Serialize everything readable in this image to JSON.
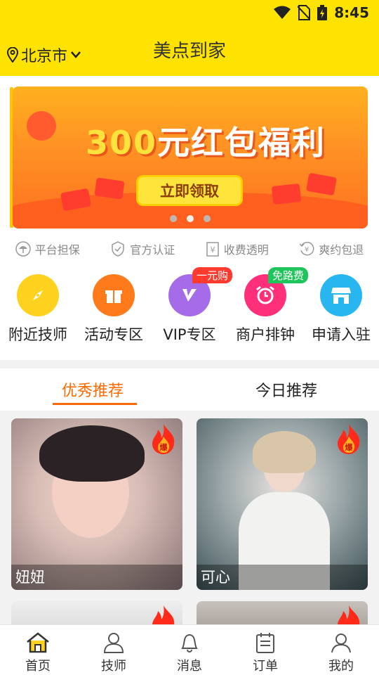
{
  "status_bar": {
    "time": "8:45"
  },
  "header": {
    "city": "北京市",
    "title": "美点到家"
  },
  "banner": {
    "headline_number": "300",
    "headline_text": "元红包福利",
    "cta_label": "立即领取",
    "pages": 3,
    "active_page": 2
  },
  "guarantees": [
    {
      "icon": "umbrella-icon",
      "label": "平台担保"
    },
    {
      "icon": "shield-check-icon",
      "label": "官方认证"
    },
    {
      "icon": "receipt-icon",
      "label": "收费透明"
    },
    {
      "icon": "refund-icon",
      "label": "爽约包退"
    }
  ],
  "categories": [
    {
      "icon": "compass-icon",
      "label": "附近技师",
      "color": "#ffd21f",
      "tag": ""
    },
    {
      "icon": "gift-icon",
      "label": "活动专区",
      "color": "#ff7a1a",
      "tag": ""
    },
    {
      "icon": "vip-icon",
      "label": "VIP专区",
      "color": "#a56be8",
      "tag": "一元购",
      "tag_color": "#ff3b30"
    },
    {
      "icon": "alarm-clock-icon",
      "label": "商户排钟",
      "color": "#ff2f7a",
      "tag": "免路费",
      "tag_color": "#1fc45a"
    },
    {
      "icon": "store-icon",
      "label": "申请入驻",
      "color": "#27b6f0",
      "tag": ""
    }
  ],
  "tabs": {
    "active": "优秀推荐",
    "inactive": "今日推荐"
  },
  "cards": [
    {
      "name": "妞妞",
      "badge": "爆"
    },
    {
      "name": "可心",
      "badge": "爆"
    }
  ],
  "bottom_nav": [
    {
      "icon": "home-icon",
      "label": "首页",
      "active": true
    },
    {
      "icon": "technician-icon",
      "label": "技师",
      "active": false
    },
    {
      "icon": "bell-icon",
      "label": "消息",
      "active": false
    },
    {
      "icon": "order-icon",
      "label": "订单",
      "active": false
    },
    {
      "icon": "user-icon",
      "label": "我的",
      "active": false
    }
  ],
  "colors": {
    "brand_yellow": "#ffe300",
    "accent_orange": "#ff6a00"
  }
}
